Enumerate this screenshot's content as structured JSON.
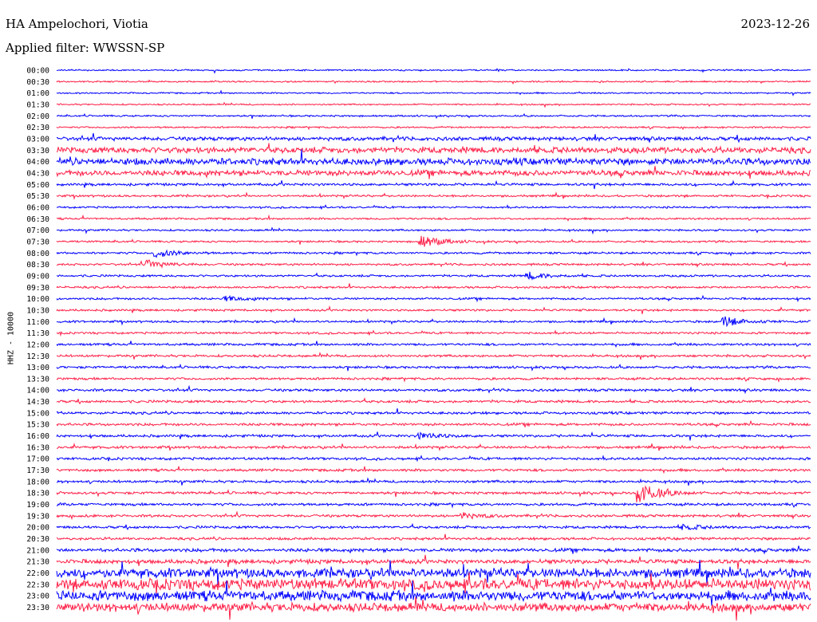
{
  "header": {
    "station": "HA Ampelochori, Viotia",
    "date": "2023-12-26",
    "filter": "Applied filter: WWSSN-SP"
  },
  "channel_label": "HHZ - 10000",
  "colors": {
    "trace_even": "#0000ff",
    "trace_odd": "#ff1e46",
    "background": "#ffffff"
  },
  "chart_data": {
    "type": "line",
    "title": "",
    "xlabel": "",
    "ylabel": "HHZ - 10000",
    "grid": false,
    "legend": "none",
    "rows": [
      "00:00",
      "00:30",
      "01:00",
      "01:30",
      "02:00",
      "02:30",
      "03:00",
      "03:30",
      "04:00",
      "04:30",
      "05:00",
      "05:30",
      "06:00",
      "06:30",
      "07:00",
      "07:30",
      "08:00",
      "08:30",
      "09:00",
      "09:30",
      "10:00",
      "10:30",
      "11:00",
      "11:30",
      "12:00",
      "12:30",
      "13:00",
      "13:30",
      "14:00",
      "14:30",
      "15:00",
      "15:30",
      "16:00",
      "16:30",
      "17:00",
      "17:30",
      "18:00",
      "18:30",
      "19:00",
      "19:30",
      "20:00",
      "20:30",
      "21:00",
      "21:30",
      "22:00",
      "22:30",
      "23:00",
      "23:30"
    ],
    "row_minutes": 30,
    "noise_level": [
      0.35,
      0.35,
      0.35,
      0.35,
      0.4,
      0.4,
      0.9,
      1.4,
      1.6,
      1.3,
      0.6,
      0.5,
      0.45,
      0.45,
      0.45,
      0.45,
      0.5,
      0.5,
      0.5,
      0.5,
      0.5,
      0.5,
      0.5,
      0.5,
      0.55,
      0.55,
      0.55,
      0.55,
      0.6,
      0.6,
      0.6,
      0.6,
      0.6,
      0.6,
      0.6,
      0.6,
      0.6,
      0.6,
      0.6,
      0.6,
      0.6,
      0.6,
      0.8,
      1.0,
      2.2,
      2.6,
      2.4,
      2.0
    ],
    "events": [
      {
        "row": 15,
        "minute": 14.5,
        "amplitude": 3.5
      },
      {
        "row": 16,
        "minute": 4.0,
        "amplitude": 2.2
      },
      {
        "row": 17,
        "minute": 3.7,
        "amplitude": 2.0
      },
      {
        "row": 18,
        "minute": 18.8,
        "amplitude": 1.8
      },
      {
        "row": 20,
        "minute": 6.8,
        "amplitude": 1.2
      },
      {
        "row": 22,
        "minute": 26.6,
        "amplitude": 2.6
      },
      {
        "row": 32,
        "minute": 14.5,
        "amplitude": 1.6
      },
      {
        "row": 37,
        "minute": 23.2,
        "amplitude": 6.0
      },
      {
        "row": 39,
        "minute": 16.2,
        "amplitude": 1.4
      },
      {
        "row": 40,
        "minute": 25.0,
        "amplitude": 1.2
      }
    ]
  }
}
